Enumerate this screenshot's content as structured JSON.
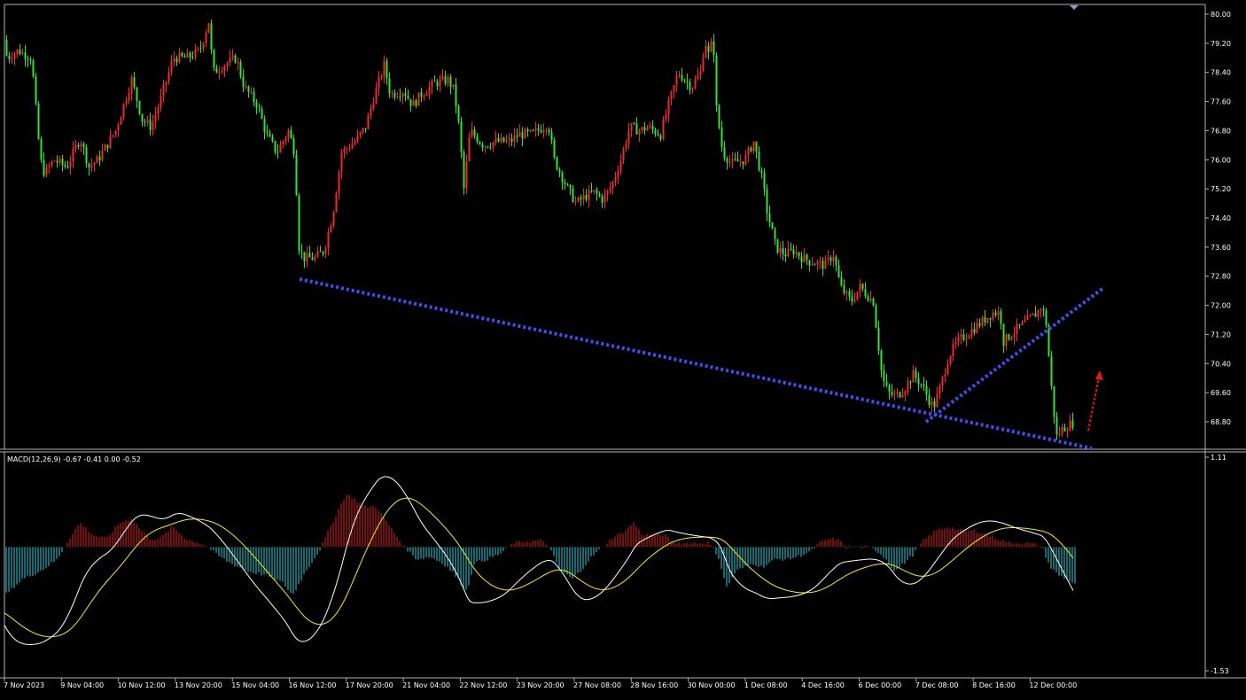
{
  "chart_data": [
    {
      "type": "candlestick",
      "panel": "price",
      "title": "",
      "xlabel": "",
      "ylabel": "",
      "ylim": [
        67.96,
        80.24
      ],
      "y_ticks": [
        "80.00",
        "79.20",
        "78.40",
        "77.60",
        "76.80",
        "76.00",
        "75.20",
        "74.40",
        "73.60",
        "72.80",
        "72.00",
        "71.20",
        "70.40",
        "69.60",
        "68.80"
      ],
      "x_ticks": [
        "7 Nov 2023",
        "9 Nov 04:00",
        "10 Nov 12:00",
        "13 Nov 20:00",
        "15 Nov 04:00",
        "16 Nov 12:00",
        "17 Nov 20:00",
        "21 Nov 04:00",
        "22 Nov 12:00",
        "23 Nov 20:00",
        "27 Nov 08:00",
        "28 Nov 16:00",
        "30 Nov 00:00",
        "1 Dec 08:00",
        "4 Dec 16:00",
        "6 Dec 00:00",
        "7 Dec 08:00",
        "8 Dec 16:00",
        "12 Dec 00:00"
      ],
      "bullish_color": "#ef2a2a",
      "bearish_color": "#34e234",
      "close_path": [
        [
          0,
          79.3
        ],
        [
          8,
          78.8
        ],
        [
          20,
          79.0
        ],
        [
          35,
          78.8
        ],
        [
          45,
          76.0
        ],
        [
          50,
          75.6
        ],
        [
          60,
          76.0
        ],
        [
          75,
          75.8
        ],
        [
          90,
          76.6
        ],
        [
          100,
          75.8
        ],
        [
          110,
          76.0
        ],
        [
          130,
          76.8
        ],
        [
          148,
          78.2
        ],
        [
          160,
          77.1
        ],
        [
          170,
          76.9
        ],
        [
          180,
          77.6
        ],
        [
          195,
          78.8
        ],
        [
          210,
          78.8
        ],
        [
          225,
          79.0
        ],
        [
          235,
          79.8
        ],
        [
          240,
          78.4
        ],
        [
          252,
          78.6
        ],
        [
          266,
          78.8
        ],
        [
          275,
          78.0
        ],
        [
          290,
          77.5
        ],
        [
          300,
          76.7
        ],
        [
          312,
          76.2
        ],
        [
          325,
          76.8
        ],
        [
          332,
          76.2
        ],
        [
          337,
          73.6
        ],
        [
          342,
          73.3
        ],
        [
          355,
          73.3
        ],
        [
          365,
          73.5
        ],
        [
          375,
          74.5
        ],
        [
          385,
          76.2
        ],
        [
          400,
          76.5
        ],
        [
          412,
          76.9
        ],
        [
          420,
          77.6
        ],
        [
          433,
          78.6
        ],
        [
          440,
          77.8
        ],
        [
          455,
          77.9
        ],
        [
          465,
          77.5
        ],
        [
          475,
          77.8
        ],
        [
          490,
          78.1
        ],
        [
          505,
          78.2
        ],
        [
          512,
          77.9
        ],
        [
          518,
          76.8
        ],
        [
          523,
          75.2
        ],
        [
          530,
          76.8
        ],
        [
          545,
          76.4
        ],
        [
          560,
          76.5
        ],
        [
          575,
          76.5
        ],
        [
          585,
          76.7
        ],
        [
          600,
          76.7
        ],
        [
          618,
          77.0
        ],
        [
          625,
          76.0
        ],
        [
          640,
          75.2
        ],
        [
          650,
          74.8
        ],
        [
          660,
          75.0
        ],
        [
          670,
          75.1
        ],
        [
          680,
          74.9
        ],
        [
          690,
          75.3
        ],
        [
          700,
          76.0
        ],
        [
          710,
          76.9
        ],
        [
          722,
          76.8
        ],
        [
          730,
          76.9
        ],
        [
          745,
          76.7
        ],
        [
          755,
          77.6
        ],
        [
          765,
          78.4
        ],
        [
          780,
          78.0
        ],
        [
          790,
          78.4
        ],
        [
          795,
          79.3
        ],
        [
          800,
          78.8
        ],
        [
          804,
          79.5
        ],
        [
          808,
          77.4
        ],
        [
          815,
          76.2
        ],
        [
          825,
          75.9
        ],
        [
          840,
          76.0
        ],
        [
          850,
          76.5
        ],
        [
          860,
          75.4
        ],
        [
          865,
          74.6
        ],
        [
          875,
          73.6
        ],
        [
          885,
          73.4
        ],
        [
          895,
          73.5
        ],
        [
          905,
          73.3
        ],
        [
          915,
          73.2
        ],
        [
          930,
          73.1
        ],
        [
          940,
          73.4
        ],
        [
          948,
          72.5
        ],
        [
          960,
          72.1
        ],
        [
          970,
          72.5
        ],
        [
          985,
          72.1
        ],
        [
          995,
          70.0
        ],
        [
          1002,
          69.6
        ],
        [
          1010,
          69.5
        ],
        [
          1020,
          69.7
        ],
        [
          1030,
          70.1
        ],
        [
          1040,
          69.8
        ],
        [
          1048,
          69.4
        ],
        [
          1053,
          69.2
        ],
        [
          1060,
          69.7
        ],
        [
          1070,
          70.6
        ],
        [
          1080,
          71.0
        ],
        [
          1090,
          71.2
        ],
        [
          1100,
          71.4
        ],
        [
          1110,
          71.6
        ],
        [
          1120,
          71.8
        ],
        [
          1128,
          71.8
        ],
        [
          1132,
          71.0
        ],
        [
          1140,
          71.2
        ],
        [
          1150,
          71.4
        ],
        [
          1160,
          71.6
        ],
        [
          1170,
          71.8
        ],
        [
          1175,
          72.0
        ],
        [
          1180,
          71.5
        ],
        [
          1185,
          70.0
        ],
        [
          1188,
          69.2
        ],
        [
          1192,
          68.4
        ],
        [
          1198,
          68.6
        ],
        [
          1205,
          68.7
        ],
        [
          1212,
          68.8
        ]
      ]
    },
    {
      "type": "macd",
      "panel": "indicator",
      "label": "MACD(12,26,9) -0.67 -0.41 0.00 -0.52",
      "ylim": [
        -1.53,
        1.11
      ],
      "y_ticks": [
        "1.11",
        "-1.53"
      ],
      "histogram_positive_color": "#e02020",
      "histogram_negative_color": "#30d0e0",
      "signal_color": "#f0f020",
      "main_color": "#ffffff",
      "zero_line": 0,
      "hist_path": [
        [
          5,
          -0.6
        ],
        [
          25,
          -0.4
        ],
        [
          45,
          -0.3
        ],
        [
          65,
          -0.15
        ],
        [
          75,
          0.05
        ],
        [
          90,
          0.3
        ],
        [
          105,
          0.15
        ],
        [
          120,
          0.1
        ],
        [
          135,
          0.3
        ],
        [
          148,
          0.35
        ],
        [
          160,
          0.2
        ],
        [
          170,
          0.1
        ],
        [
          180,
          0.1
        ],
        [
          195,
          0.25
        ],
        [
          210,
          0.1
        ],
        [
          225,
          0.05
        ],
        [
          235,
          0.0
        ],
        [
          245,
          -0.1
        ],
        [
          260,
          -0.2
        ],
        [
          280,
          -0.3
        ],
        [
          300,
          -0.35
        ],
        [
          320,
          -0.45
        ],
        [
          330,
          -0.6
        ],
        [
          345,
          -0.3
        ],
        [
          360,
          -0.05
        ],
        [
          375,
          0.3
        ],
        [
          390,
          0.65
        ],
        [
          400,
          0.6
        ],
        [
          410,
          0.5
        ],
        [
          425,
          0.5
        ],
        [
          440,
          0.25
        ],
        [
          455,
          0.02
        ],
        [
          470,
          -0.15
        ],
        [
          485,
          -0.12
        ],
        [
          500,
          -0.2
        ],
        [
          510,
          -0.3
        ],
        [
          520,
          -0.45
        ],
        [
          527,
          -0.55
        ],
        [
          535,
          -0.2
        ],
        [
          550,
          -0.15
        ],
        [
          565,
          -0.08
        ],
        [
          580,
          0.05
        ],
        [
          595,
          0.07
        ],
        [
          610,
          0.08
        ],
        [
          620,
          0.0
        ],
        [
          630,
          -0.25
        ],
        [
          645,
          -0.4
        ],
        [
          655,
          -0.3
        ],
        [
          665,
          -0.15
        ],
        [
          675,
          -0.05
        ],
        [
          690,
          0.1
        ],
        [
          705,
          0.2
        ],
        [
          715,
          0.3
        ],
        [
          725,
          0.15
        ],
        [
          740,
          0.15
        ],
        [
          750,
          0.15
        ],
        [
          760,
          0.05
        ],
        [
          775,
          0.05
        ],
        [
          790,
          0.05
        ],
        [
          800,
          0.05
        ],
        [
          810,
          -0.1
        ],
        [
          820,
          -0.5
        ],
        [
          830,
          -0.3
        ],
        [
          840,
          -0.25
        ],
        [
          850,
          -0.2
        ],
        [
          860,
          -0.25
        ],
        [
          875,
          -0.15
        ],
        [
          890,
          -0.15
        ],
        [
          905,
          -0.1
        ],
        [
          915,
          -0.05
        ],
        [
          925,
          0.05
        ],
        [
          935,
          0.1
        ],
        [
          945,
          0.1
        ],
        [
          955,
          0.0
        ],
        [
          965,
          0.0
        ],
        [
          980,
          0.0
        ],
        [
          990,
          -0.05
        ],
        [
          1000,
          -0.15
        ],
        [
          1010,
          -0.3
        ],
        [
          1020,
          -0.2
        ],
        [
          1030,
          -0.1
        ],
        [
          1040,
          0.05
        ],
        [
          1055,
          0.2
        ],
        [
          1070,
          0.25
        ],
        [
          1085,
          0.2
        ],
        [
          1100,
          0.2
        ],
        [
          1115,
          0.15
        ],
        [
          1125,
          0.1
        ],
        [
          1140,
          0.05
        ],
        [
          1160,
          0.05
        ],
        [
          1175,
          0.02
        ],
        [
          1185,
          -0.25
        ],
        [
          1195,
          -0.35
        ],
        [
          1205,
          -0.4
        ],
        [
          1212,
          -0.45
        ]
      ]
    }
  ],
  "annotations": {
    "trendline_color": "#3f4ff0",
    "arrow_color": "#e01818"
  }
}
